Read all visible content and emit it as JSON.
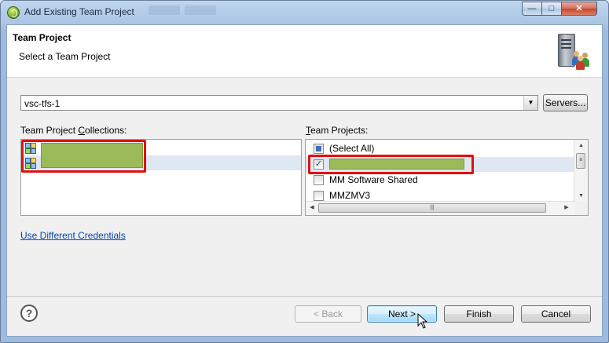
{
  "window": {
    "title": "Add Existing Team Project",
    "buttons": {
      "minimize": "—",
      "maximize": "□",
      "close": "✕"
    }
  },
  "header": {
    "title": "Team Project",
    "subtitle": "Select a Team Project",
    "icon": "server-users-icon"
  },
  "server": {
    "selected": "vsc-tfs-1",
    "servers_button": "Servers..."
  },
  "collections": {
    "label_pre": "Team Project ",
    "label_mnemonic": "C",
    "label_post": "ollections:",
    "items": [
      {
        "text": "",
        "redacted": true
      },
      {
        "text": "",
        "redacted": true
      }
    ]
  },
  "projects": {
    "label_mnemonic": "T",
    "label_post": "eam Projects:",
    "items": [
      {
        "text": "(Select All)",
        "state": "partial"
      },
      {
        "text": "",
        "state": "checked",
        "redacted": true
      },
      {
        "text": "MM Software Shared",
        "state": "unchecked"
      },
      {
        "text": "MMZMV3",
        "state": "unchecked"
      }
    ],
    "check_mark": "✓"
  },
  "links": {
    "credentials": "Use Different Credentials"
  },
  "footer": {
    "help": "?",
    "back_label": "< Back",
    "back_mnemonic": "B",
    "next_label": "Next >",
    "next_mnemonic": "N",
    "finish_label": "Finish",
    "cancel_label": "Cancel"
  },
  "colors": {
    "redaction": "#9bbb59",
    "highlight_box": "#e01010",
    "link": "#0645ad",
    "selection": "#dfe7f3"
  }
}
